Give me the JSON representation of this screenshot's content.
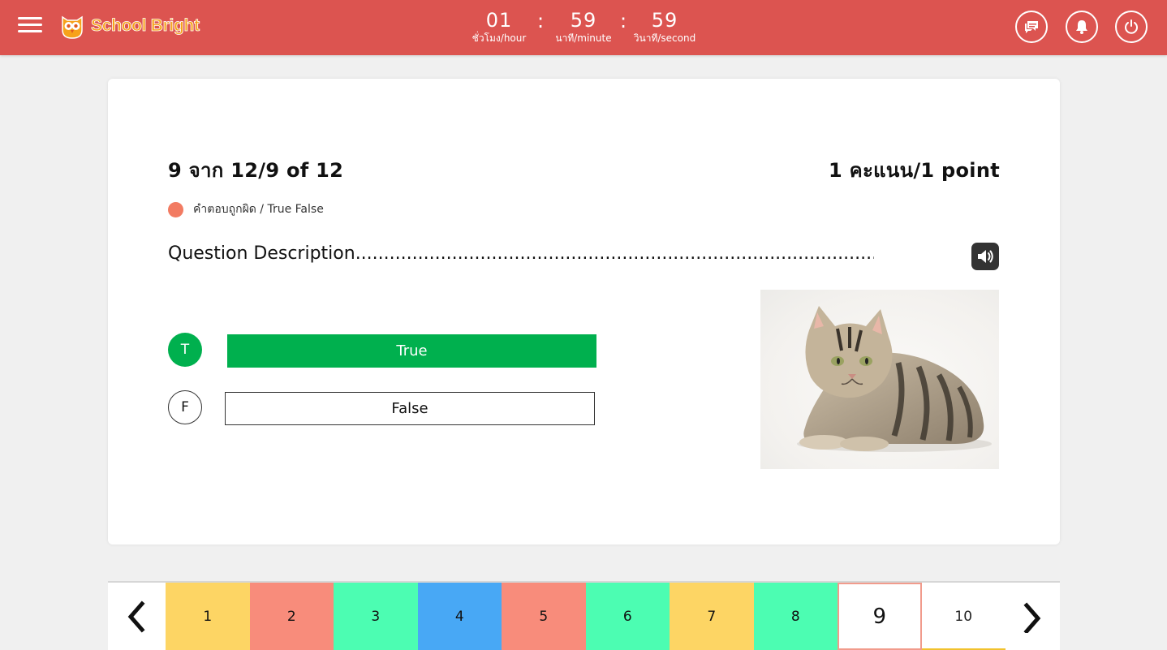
{
  "header": {
    "brand": "School Bright",
    "menu_icon": "hamburger-menu-icon",
    "timer": {
      "hours": "01",
      "hours_unit": "ชั่วโมง/hour",
      "minutes": "59",
      "minutes_unit": "นาที/minute",
      "seconds": "59",
      "seconds_unit": "วินาที/second",
      "separator": ":"
    },
    "actions": [
      {
        "name": "chat-icon"
      },
      {
        "name": "bell-icon"
      },
      {
        "name": "power-icon"
      }
    ],
    "colors": {
      "bar": "#dc5450",
      "brand_text": "#f7a21b"
    }
  },
  "question": {
    "counter": "9 จาก 12/9 of 12",
    "points": "1 คะแนน/1 point",
    "type_label": "คำตอบถูกผิด / True False",
    "type_color": "#f27b62",
    "description": "Question Description.........................................................................................................................",
    "speaker_icon": "speaker-icon",
    "image_icon": "kitten-photo",
    "choices": [
      {
        "key": "T",
        "label": "True",
        "selected": true,
        "color": "#00b04e"
      },
      {
        "key": "F",
        "label": "False",
        "selected": false
      }
    ]
  },
  "navigator": {
    "prev_icon": "chevron-left-icon",
    "next_icon": "chevron-right-icon",
    "tiles": [
      {
        "label": "1",
        "color": "#fdd564"
      },
      {
        "label": "2",
        "color": "#f88c7b"
      },
      {
        "label": "3",
        "color": "#4cfdb2"
      },
      {
        "label": "4",
        "color": "#48a8f5"
      },
      {
        "label": "5",
        "color": "#f88c7b"
      },
      {
        "label": "6",
        "color": "#4cfdb2"
      },
      {
        "label": "7",
        "color": "#fdd564"
      },
      {
        "label": "8",
        "color": "#4cfdb2"
      },
      {
        "label": "9",
        "color": "#ffffff",
        "current": true
      },
      {
        "label": "10",
        "color": "#ffffff"
      }
    ]
  }
}
